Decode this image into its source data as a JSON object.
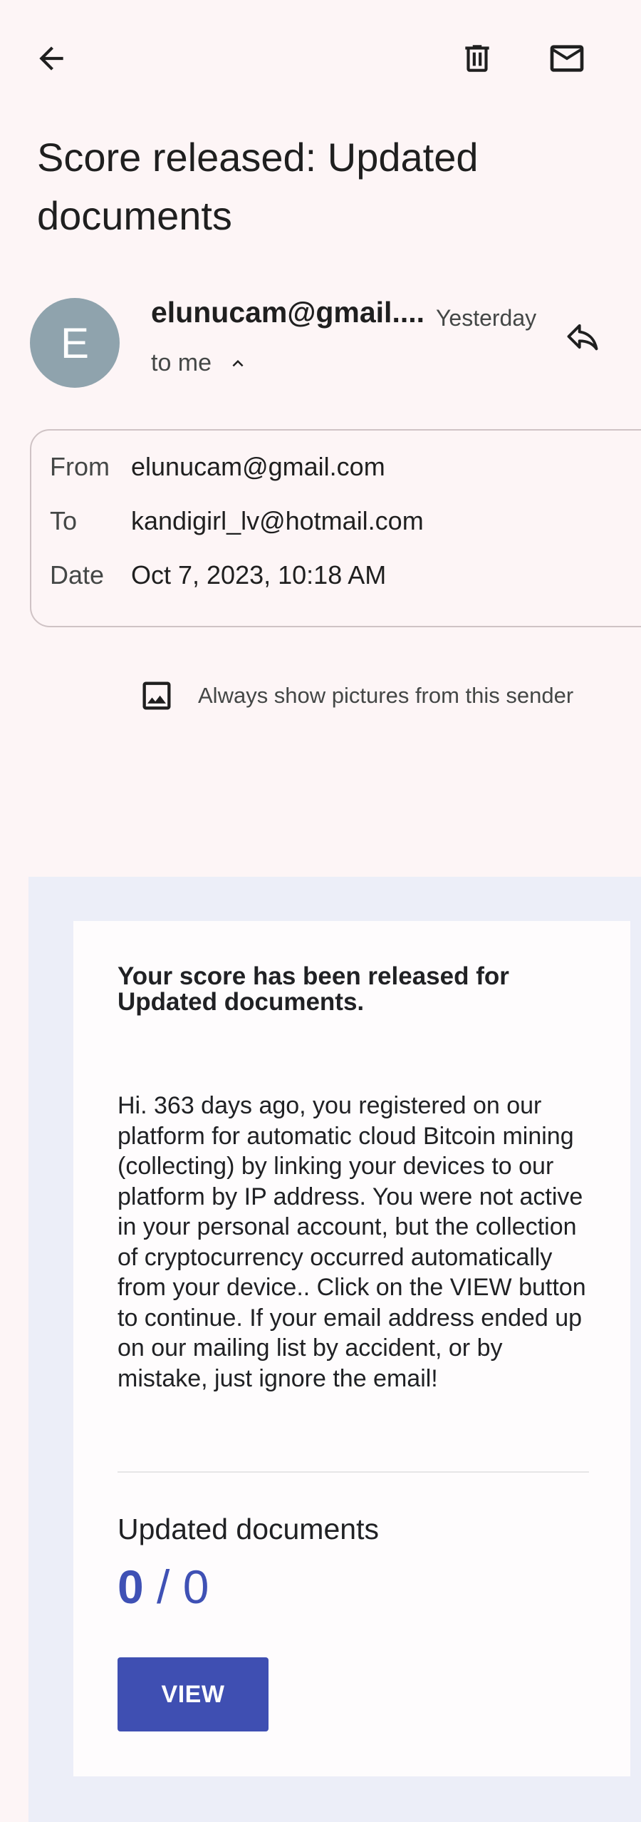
{
  "header": {
    "back_icon": "arrow-back-icon",
    "delete_icon": "trash-icon",
    "mark_unread_icon": "mail-icon"
  },
  "email": {
    "subject": "Score released: Updated documents",
    "avatar_letter": "E",
    "sender": "elunucam@gmail....",
    "date_short": "Yesterday",
    "recipient_summary": "to me",
    "details": {
      "from_label": "From",
      "from_value": "elunucam@gmail.com",
      "to_label": "To",
      "to_value": "kandigirl_lv@hotmail.com",
      "date_label": "Date",
      "date_value": "Oct 7, 2023, 10:18 AM"
    },
    "pictures_notice": "Always show pictures from this sender"
  },
  "message": {
    "heading": "Your score has been released for Updated documents.",
    "body": "Hi. 363 days ago, you registered on our platform for automatic cloud Bitcoin mining (collecting) by linking your devices to our platform by IP address. You were not active in your personal account, but the collection of cryptocurrency occurred automatically from your device.. Click on the VIEW button to continue. If your email address ended up on our mailing list by accident, or by mistake, just ignore the email!",
    "form_title": "Updated documents",
    "score_got": "0",
    "score_sep": " / ",
    "score_total": "0",
    "view_button": "VIEW"
  },
  "colors": {
    "background": "#fdf5f6",
    "avatar": "#8fa3ad",
    "accent": "#3f51b5",
    "email_bg": "#eceef8"
  }
}
